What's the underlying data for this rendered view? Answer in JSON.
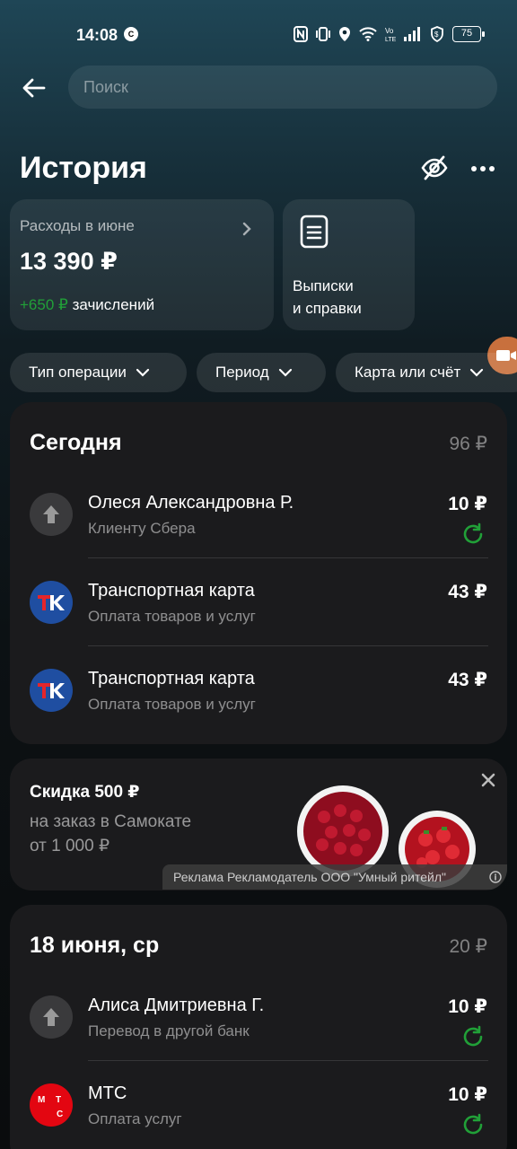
{
  "status_bar": {
    "time": "14:08",
    "left_icon": "C",
    "battery": "75",
    "icons": [
      "nfc-icon",
      "vibrate-icon",
      "location-icon",
      "wifi-icon",
      "volte-icon",
      "signal-icon",
      "shield-icon",
      "battery-icon"
    ]
  },
  "search": {
    "placeholder": "Поиск"
  },
  "page": {
    "title": "История"
  },
  "summary": {
    "spend_title": "Расходы в июне",
    "spend_amount": "13 390 ₽",
    "credit_amount": "+650 ₽",
    "credit_label": "зачислений",
    "statements_label": "Выписки\nи справки"
  },
  "filters": [
    "Тип операции",
    "Период",
    "Карта или счёт"
  ],
  "sections": [
    {
      "date": "Сегодня",
      "total": "96 ₽",
      "transactions": [
        {
          "name": "Олеся Александровна Р.",
          "sub": "Клиенту Сбера",
          "amount": "10 ₽",
          "avatar": "arrow-up-icon",
          "repeat": true
        },
        {
          "name": "Транспортная карта",
          "sub": "Оплата товаров и услуг",
          "amount": "43 ₽",
          "avatar": "tk-logo",
          "avatar_text": "TK",
          "repeat": false
        },
        {
          "name": "Транспортная карта",
          "sub": "Оплата товаров и услуг",
          "amount": "43 ₽",
          "avatar": "tk-logo",
          "avatar_text": "TK",
          "repeat": false
        }
      ]
    },
    {
      "date": "18 июня, ср",
      "total": "20 ₽",
      "transactions": [
        {
          "name": "Алиса Дмитриевна Г.",
          "sub": "Перевод в другой банк",
          "amount": "10 ₽",
          "avatar": "arrow-up-icon",
          "repeat": true
        },
        {
          "name": "МТС",
          "sub": "Оплата услуг",
          "amount": "10 ₽",
          "avatar": "mts-logo",
          "avatar_text": "М Т С",
          "repeat": true
        }
      ]
    }
  ],
  "ad": {
    "title": "Скидка 500 ₽",
    "text": "на заказ в Самокате\nот 1 000 ₽",
    "disclaimer": "Реклама Рекламодатель ООО \"Умный ритейл\""
  },
  "colors": {
    "accent_green": "#21a038",
    "tk_blue": "#1f4ea1",
    "mts_red": "#e30611"
  }
}
